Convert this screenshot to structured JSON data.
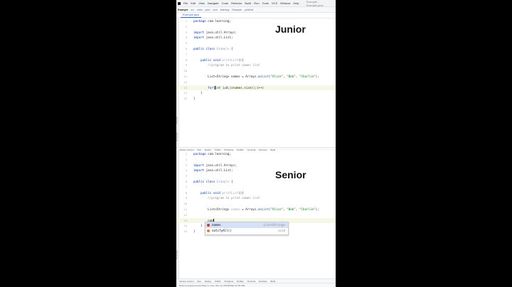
{
  "ide": {
    "menu_items": [
      "File",
      "Edit",
      "View",
      "Navigate",
      "Code",
      "Refactor",
      "Build",
      "Run",
      "Tools",
      "VCS",
      "Window",
      "Help"
    ],
    "window_title": "Example - Example.java",
    "nav_items": [
      "Example",
      "src",
      "main",
      "java",
      "com",
      "learning",
      "Example",
      "printList"
    ],
    "tab_label": "Example.java",
    "tool_windows": [
      "Version Control",
      "Run",
      "Debug",
      "TODO",
      "Problems",
      "Profiler",
      "Terminal",
      "Services",
      "Build"
    ],
    "side_labels": [
      "Structure",
      "Bookmarks"
    ],
    "status_text": "Build completed successfully in 1 sec, 821 ms (15/05/2024 12:32 AM)"
  },
  "top_panel": {
    "caption": "Junior",
    "lines": [
      {
        "n": "1",
        "text": "package com.learning;"
      },
      {
        "n": "2",
        "text": ""
      },
      {
        "n": "3",
        "text": "import java.util.Arrays;"
      },
      {
        "n": "4",
        "text": "import java.util.List;"
      },
      {
        "n": "5",
        "text": ""
      },
      {
        "n": "6",
        "text": "public class Example {"
      },
      {
        "n": "7",
        "text": ""
      },
      {
        "n": "8",
        "text": "    public void printList(){"
      },
      {
        "n": "9",
        "text": "        //program to print names list"
      },
      {
        "n": "10",
        "text": ""
      },
      {
        "n": "11",
        "text": "        List<String> names = Arrays.asList(\"Alice\", \"Bob\", \"Charlie\");"
      },
      {
        "n": "12",
        "text": ""
      },
      {
        "n": "13",
        "text": "        for(int i=0;i<names.size();i++)"
      },
      {
        "n": "14",
        "text": "    }"
      },
      {
        "n": "15",
        "text": "}"
      }
    ]
  },
  "bottom_panel": {
    "caption": "Senior",
    "lines": [
      {
        "n": "1",
        "text": "package com.learning;"
      },
      {
        "n": "2",
        "text": ""
      },
      {
        "n": "3",
        "text": "import java.util.Arrays;"
      },
      {
        "n": "4",
        "text": "import java.util.List;"
      },
      {
        "n": "5",
        "text": ""
      },
      {
        "n": "6",
        "text": "public class Example {"
      },
      {
        "n": "7",
        "text": ""
      },
      {
        "n": "8",
        "text": "    public void printList(){"
      },
      {
        "n": "9",
        "text": "        //program to print names list"
      },
      {
        "n": "10",
        "text": ""
      },
      {
        "n": "11",
        "text": "        List<String> names = Arrays.asList(\"Alice\", \"Bob\", \"Charlie\");"
      },
      {
        "n": "12",
        "text": ""
      },
      {
        "n": "13",
        "text": "        nam"
      },
      {
        "n": "14",
        "text": "    }"
      },
      {
        "n": "15",
        "text": "}"
      }
    ],
    "completion": [
      {
        "name": "names",
        "type": "List<String>",
        "icon_color": "#c0392b"
      },
      {
        "name": "notifyAll()",
        "type": "void",
        "icon_color": "#e67e22"
      }
    ]
  }
}
